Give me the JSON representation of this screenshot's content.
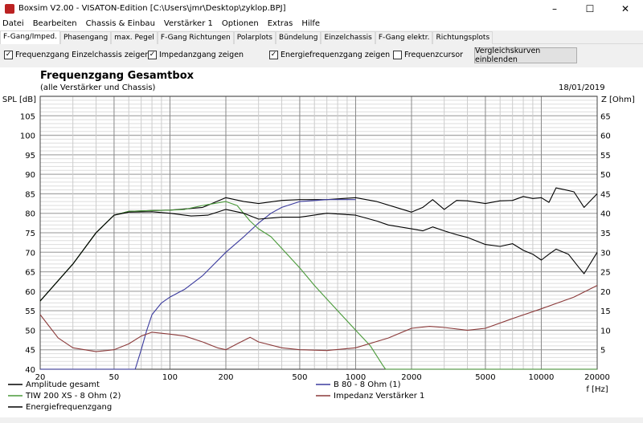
{
  "window": {
    "title": "Boxsim V2.00 - VISATON-Edition [C:\\Users\\jmr\\Desktop\\zyklop.BPJ]",
    "minimize": "–",
    "maximize": "☐",
    "close": "✕"
  },
  "menu": [
    "Datei",
    "Bearbeiten",
    "Chassis & Einbau",
    "Verstärker 1",
    "Optionen",
    "Extras",
    "Hilfe"
  ],
  "tabs": [
    "F-Gang/Imped.",
    "Phasengang",
    "max. Pegel",
    "F-Gang Richtungen",
    "Polarplots",
    "Bündelung",
    "Einzelchassis",
    "F-Gang elektr.",
    "Richtungsplots"
  ],
  "options": [
    {
      "label": "Frequenzgang Einzelchassis zeigen",
      "checked": true
    },
    {
      "label": "Impedanzgang zeigen",
      "checked": true
    },
    {
      "label": "Energiefrequenzgang zeigen",
      "checked": true
    },
    {
      "label": "Frequenzcursor",
      "checked": false
    }
  ],
  "compare_button": "Vergleichskurven einblenden",
  "chart_data": {
    "type": "line",
    "title": "Frequenzgang Gesamtbox",
    "subtitle": "(alle Verstärker und Chassis)",
    "date": "18/01/2019",
    "ylabel": "SPL [dB]",
    "y2label": "Z [Ohm]",
    "xlabel": "f [Hz]",
    "xscale": "log",
    "xlim": [
      20,
      20000
    ],
    "ylim": [
      40,
      110
    ],
    "y2lim": [
      0,
      70
    ],
    "xticks": [
      20,
      50,
      100,
      200,
      500,
      1000,
      2000,
      5000,
      10000,
      20000
    ],
    "yticks": [
      40,
      45,
      50,
      55,
      60,
      65,
      70,
      75,
      80,
      85,
      90,
      95,
      100,
      105
    ],
    "y2ticks": [
      5,
      10,
      15,
      20,
      25,
      30,
      35,
      40,
      45,
      50,
      55,
      60,
      65
    ],
    "series": [
      {
        "name": "Amplitude gesamt",
        "color": "#000000",
        "axis": "left",
        "x": [
          20,
          30,
          40,
          50,
          60,
          80,
          100,
          150,
          200,
          250,
          300,
          400,
          500,
          700,
          1000,
          1300,
          2000,
          2300,
          2600,
          3000,
          3500,
          4000,
          5000,
          6000,
          7000,
          8000,
          9000,
          10000,
          11000,
          12000,
          13500,
          15000,
          17000,
          20000
        ],
        "y": [
          57.5,
          67,
          75,
          79.5,
          80.5,
          80.7,
          80.8,
          81.5,
          84,
          83,
          82.5,
          83.3,
          83.5,
          83.5,
          84,
          83,
          80.3,
          81.5,
          83.5,
          81,
          83.3,
          83.2,
          82.5,
          83.2,
          83.3,
          84.3,
          83.8,
          84,
          82.8,
          86.5,
          86,
          85.5,
          81.5,
          85
        ]
      },
      {
        "name": "B 80 - 8 Ohm (1)",
        "color": "#3b3b9e",
        "axis": "left",
        "x": [
          20,
          65,
          70,
          75,
          80,
          90,
          100,
          120,
          150,
          200,
          250,
          300,
          350,
          400,
          500,
          700,
          1000
        ],
        "y": [
          40,
          40,
          45,
          50,
          54,
          57,
          58.5,
          60.5,
          64,
          70,
          74,
          77.5,
          80,
          81.5,
          83,
          83.5,
          83.5
        ]
      },
      {
        "name": "TIW 200 XS - 8 Ohm (2)",
        "color": "#4a9a3a",
        "axis": "left",
        "x": [
          20,
          30,
          40,
          50,
          60,
          80,
          100,
          120,
          150,
          200,
          230,
          270,
          300,
          350,
          400,
          500,
          600,
          700,
          800,
          1000,
          1200,
          1400,
          1450,
          20000
        ],
        "y": [
          57.5,
          67,
          75,
          79.5,
          80.5,
          80.7,
          80.8,
          81,
          82,
          83,
          82,
          78,
          76,
          74,
          71,
          66,
          61.5,
          58,
          55,
          50,
          46,
          41,
          40,
          40
        ]
      },
      {
        "name": "Impedanz Verstärker 1",
        "color": "#8b3a3a",
        "axis": "right",
        "x": [
          20,
          25,
          30,
          40,
          50,
          60,
          70,
          80,
          100,
          120,
          150,
          180,
          200,
          230,
          270,
          300,
          400,
          500,
          700,
          1000,
          1500,
          2000,
          2500,
          3000,
          4000,
          5000,
          7000,
          10000,
          15000,
          20000
        ],
        "y": [
          14,
          8,
          5.5,
          4.5,
          5,
          6.5,
          8.5,
          9.5,
          9,
          8.5,
          7,
          5.5,
          5,
          6.5,
          8.2,
          7,
          5.5,
          5,
          4.8,
          5.5,
          8,
          10.5,
          11,
          10.7,
          10,
          10.5,
          13,
          15.5,
          18.5,
          21.5
        ]
      },
      {
        "name": "Energiefrequenzgang",
        "color": "#000000",
        "axis": "left",
        "x": [
          20,
          30,
          40,
          50,
          60,
          80,
          100,
          130,
          160,
          200,
          250,
          300,
          400,
          500,
          700,
          1000,
          1300,
          1500,
          2000,
          2300,
          2600,
          3000,
          3500,
          4000,
          5000,
          6000,
          7000,
          8000,
          9000,
          10000,
          11000,
          12000,
          14000,
          16000,
          17000,
          20000
        ],
        "y": [
          57.5,
          67,
          75,
          79.5,
          80.3,
          80.4,
          80,
          79.3,
          79.5,
          81,
          80,
          78.5,
          79,
          79,
          80,
          79.5,
          78,
          77,
          76,
          75.5,
          76.5,
          75.5,
          74.5,
          73.8,
          72,
          71.5,
          72.2,
          70.5,
          69.5,
          68,
          69.5,
          70.8,
          69.5,
          66,
          64.5,
          70
        ]
      }
    ]
  }
}
